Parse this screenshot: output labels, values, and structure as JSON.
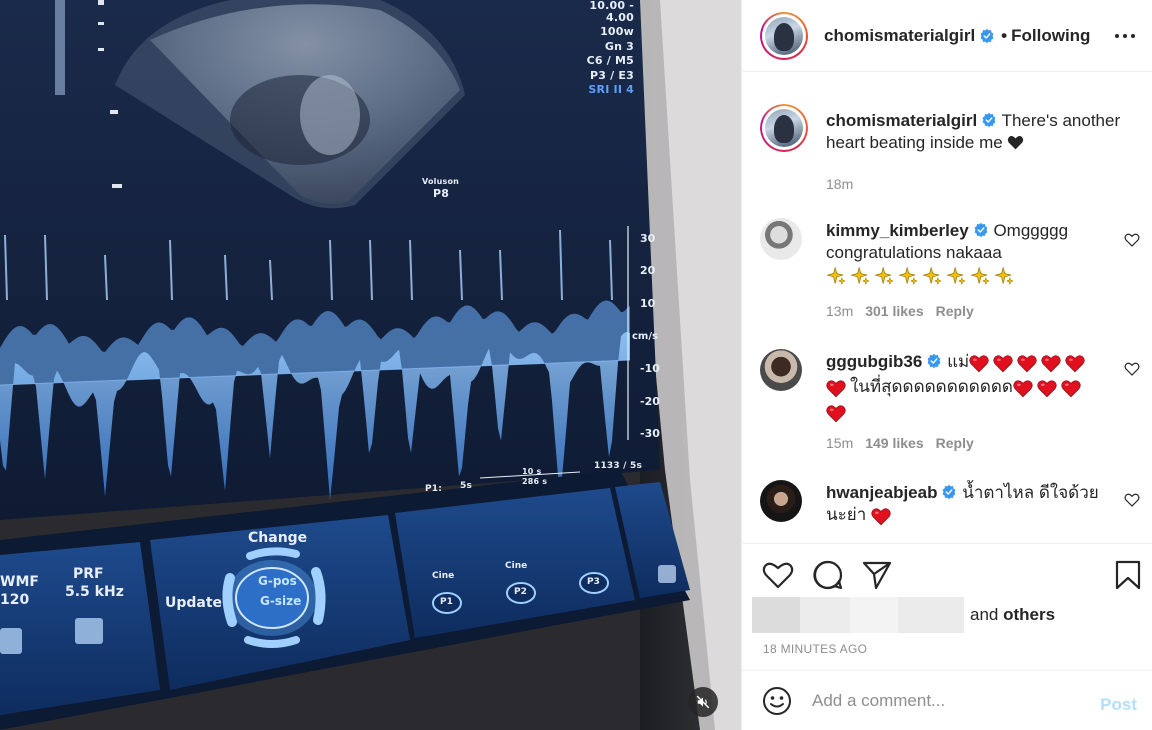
{
  "post": {
    "username": "chomismaterialgirl",
    "following_label": "Following",
    "separator": "•",
    "caption": "There's another heart beating inside me",
    "caption_emoji": "black-heart",
    "caption_time": "18m"
  },
  "comments": [
    {
      "username": "kimmy_kimberley",
      "verified": true,
      "text": "Omggggg congratulations nakaaa",
      "emoji": "sparkles x8",
      "time": "13m",
      "likes": "301 likes",
      "reply_label": "Reply"
    },
    {
      "username": "gggubgib36",
      "verified": true,
      "text_part1": "แม่",
      "text_part2": "ในที่สุดดดดดดดดดดด",
      "time": "15m",
      "likes": "149 likes",
      "reply_label": "Reply"
    },
    {
      "username": "hwanjeabjeab",
      "verified": true,
      "text": "น้ำตาไหล ดีใจด้วยนะย่า"
    }
  ],
  "likes_summary": {
    "and_label": "and",
    "others_label": "others"
  },
  "timestamp": "18 MINUTES AGO",
  "comment_box": {
    "placeholder": "Add a comment...",
    "post_label": "Post"
  },
  "ultrasound_screen": {
    "params": [
      "10.00 - 4.00",
      "100ԝ",
      "Gn  3",
      "C6 / M5",
      "P3 / E3"
    ],
    "param_blue": "SRI II 4",
    "probe_label": "Voluson",
    "probe_preset": "P8",
    "scale_values": [
      "30",
      "20",
      "10",
      "cm/s",
      "-10",
      "-20",
      "-30"
    ],
    "footer_left": "P1:",
    "footer_speed": "5s",
    "footer_mid_top": "10 s",
    "footer_mid_bottom": "286 s",
    "footer_right": "1133 / 5s",
    "panel": {
      "change": "Change",
      "update": "Update",
      "gpos": "G-pos",
      "gsize": "G-size",
      "prf": "PRF",
      "prf_value": "5.5 kHz",
      "wmf": "WMF",
      "wmf_value": "120",
      "cine1": "Cine",
      "cine2": "Cine",
      "p1": "P1",
      "p2": "P2",
      "p3": "P3"
    }
  },
  "colors": {
    "text": "#262626",
    "muted": "#8e8e8e",
    "verified": "#3897f0",
    "heart_red": "#e0101f",
    "post_disabled": "#b2dffc",
    "screen_blue": "#7ab8ff"
  }
}
